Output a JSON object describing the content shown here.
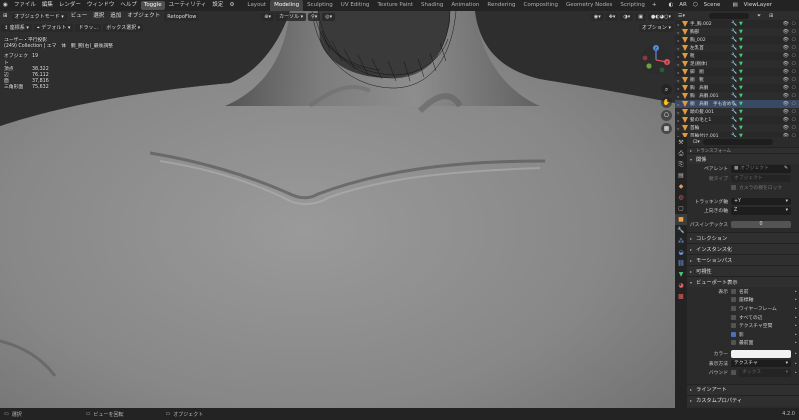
{
  "topbar": {
    "menus": [
      "ファイル",
      "編集",
      "レンダー",
      "ウィンドウ",
      "ヘルプ"
    ],
    "toggle_label": "Toggle",
    "utility_label": "ユーティリティ",
    "settings_label": "設定",
    "workspaces": [
      "Layout",
      "Modeling",
      "Sculpting",
      "UV Editing",
      "Texture Paint",
      "Shading",
      "Animation",
      "Rendering",
      "Compositing",
      "Geometry Nodes",
      "Scripting"
    ],
    "active_workspace": "Modeling",
    "ar_label": "AR",
    "scene_label": "Scene",
    "viewlayer_label": "ViewLayer"
  },
  "viewport_header": {
    "mode": "オブジェクトモード",
    "menus": [
      "ビュー",
      "選択",
      "追加",
      "オブジェクト"
    ],
    "addon": "RetopoFlow",
    "transform_orientation": "カーソル",
    "options_label": "オプション"
  },
  "viewport_header2": {
    "items": [
      "座標系",
      "デフォルト",
      "ドラッ...",
      "ボックス選択"
    ]
  },
  "overlay": {
    "view_name": "ユーザー・平行投影",
    "collection_line": "(249) Collection | エマ　体　胴_腕(右)_最後調整",
    "stats": [
      {
        "k": "オブジェクト",
        "v": "19"
      },
      {
        "k": "頂点",
        "v": "38,322"
      },
      {
        "k": "辺",
        "v": "76,112"
      },
      {
        "k": "面",
        "v": "37,816"
      },
      {
        "k": "三角形面",
        "v": "75,632"
      }
    ]
  },
  "outliner": {
    "rows": [
      {
        "name": "手_胸.002",
        "sel": false
      },
      {
        "name": "胸部",
        "sel": false
      },
      {
        "name": "胸_002",
        "sel": false
      },
      {
        "name": "左乳首",
        "sel": false
      },
      {
        "name": "靴",
        "sel": false
      },
      {
        "name": "足(胴体)",
        "sel": false
      },
      {
        "name": "脚　胴",
        "sel": false
      },
      {
        "name": "胴　靴",
        "sel": false
      },
      {
        "name": "胸　肩胴",
        "sel": false
      },
      {
        "name": "胸　肩胴.001",
        "sel": false
      },
      {
        "name": "胴　肩胴　手も含める",
        "sel": true
      },
      {
        "name": "頭の髪.001",
        "sel": false
      },
      {
        "name": "髪の毛と1",
        "sel": false
      },
      {
        "name": "首輪",
        "sel": false
      },
      {
        "name": "首輪付け.001",
        "sel": false
      }
    ]
  },
  "properties": {
    "search_placeholder": "",
    "top_section": "トランスフォーム",
    "relations": {
      "title": "関係",
      "parent_label": "ペアレント",
      "parent_value": "オブジェクト",
      "parent_type_label": "親タイプ",
      "parent_type_value": "オブジェクト",
      "camera_lock_label": "カメラの親をロック",
      "tracking_axis_label": "トラッキング軸",
      "tracking_axis_value": "+Y",
      "up_axis_label": "上向きの軸",
      "up_axis_value": "Z",
      "pass_index_label": "パスインデックス",
      "pass_index_value": "0"
    },
    "sections_collapsed": [
      "コレクション",
      "インスタンス化",
      "モーションパス",
      "可視性"
    ],
    "viewport_display": {
      "title": "ビューポート表示",
      "show_label": "表示",
      "checks": [
        {
          "label": "名前",
          "on": false
        },
        {
          "label": "座標軸",
          "on": false
        },
        {
          "label": "ワイヤーフレーム",
          "on": false
        },
        {
          "label": "すべての辺",
          "on": false
        },
        {
          "label": "テクスチャ空間",
          "on": false
        },
        {
          "label": "影",
          "on": true
        },
        {
          "label": "最前面",
          "on": false
        }
      ],
      "color_label": "カラー",
      "display_as_label": "表示方法",
      "display_as_value": "テクスチャ",
      "bounds_label": "バウンド",
      "bounds_value": "ボックス"
    },
    "sections_bottom": [
      "ラインアート",
      "カスタムプロパティ"
    ]
  },
  "statusbar": {
    "select": "選択",
    "rotate": "ビューを回転",
    "object": "オブジェクト",
    "version": "4.2.0"
  }
}
